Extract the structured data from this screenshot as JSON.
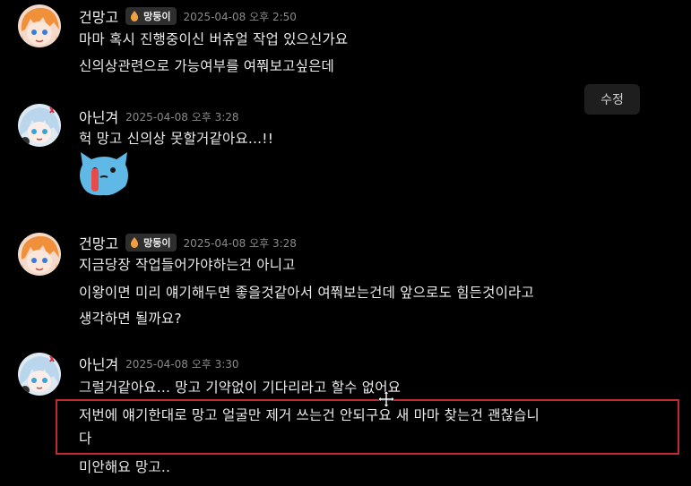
{
  "messages": [
    {
      "author": "건망고",
      "badge": "망둥이",
      "timestamp": "2025-04-08 오후 2:50",
      "lines": [
        "마마 혹시 진행중이신 버츄얼 작업 있으신가요",
        "신의상관련으로 가능여부를 여쭤보고싶은데"
      ]
    },
    {
      "author": "아닌겨",
      "timestamp": "2025-04-08 오후 3:28",
      "lines": [
        "헉 망고 신의상 못할거같아요...!!"
      ]
    },
    {
      "author": "건망고",
      "badge": "망둥이",
      "timestamp": "2025-04-08 오후 3:28",
      "lines": [
        "지금당장 작업들어가야하는건 아니고",
        "이왕이면 미리 얘기해두면 좋을것같아서 여쭤보는건데 앞으로도 힘든것이라고",
        "생각하면 될까요?"
      ]
    },
    {
      "author": "아닌겨",
      "timestamp": "2025-04-08 오후 3:30",
      "lines": [
        "그럴거같아요... 망고 기약없이 기다리라고 할수 없어요",
        "저번에 얘기한대로 망고 얼굴만 제거 쓰는건 안되구요 새 마마 찾는건 괜찮습니",
        "다",
        "미안해요 망고.."
      ]
    }
  ],
  "edit_button": "수정",
  "colors": {
    "background": "#000000",
    "highlight_border": "#c02a34",
    "badge_bg": "#2e2e2e"
  },
  "icons": [
    "avatar-orange-hair",
    "avatar-white-hair",
    "water-drop-icon",
    "blue-cat-sticker",
    "move-cursor-icon"
  ]
}
